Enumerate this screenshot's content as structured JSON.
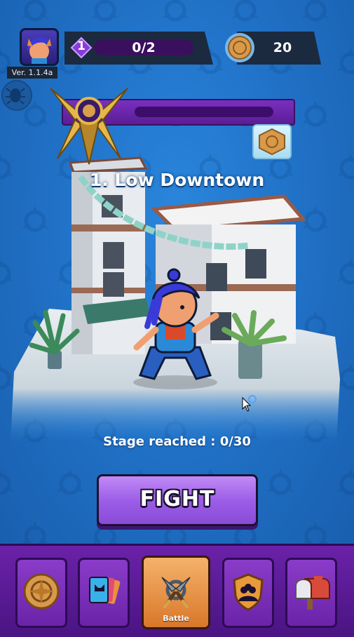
{
  "header": {
    "version": "Ver. 1.1.4a",
    "level": "1",
    "level_progress": "0/2",
    "coins": "20"
  },
  "stage": {
    "title": "1. Low Downtown",
    "reached_text": "Stage reached : 0/30",
    "progress_fraction": 0
  },
  "fight_button": {
    "label": "FIGHT"
  },
  "bottom_nav": {
    "items": [
      {
        "icon": "coin-medallion-icon",
        "label": ""
      },
      {
        "icon": "cards-icon",
        "label": ""
      },
      {
        "icon": "crossed-blades-icon",
        "label": "Battle",
        "active": true
      },
      {
        "icon": "guild-shield-icon",
        "label": ""
      },
      {
        "icon": "mailbox-icon",
        "label": ""
      }
    ]
  },
  "colors": {
    "background": "#1f6fc4",
    "nav": "#5a1a95",
    "accent_purple": "#9c5ee8",
    "active_tab": "#e8923a"
  }
}
